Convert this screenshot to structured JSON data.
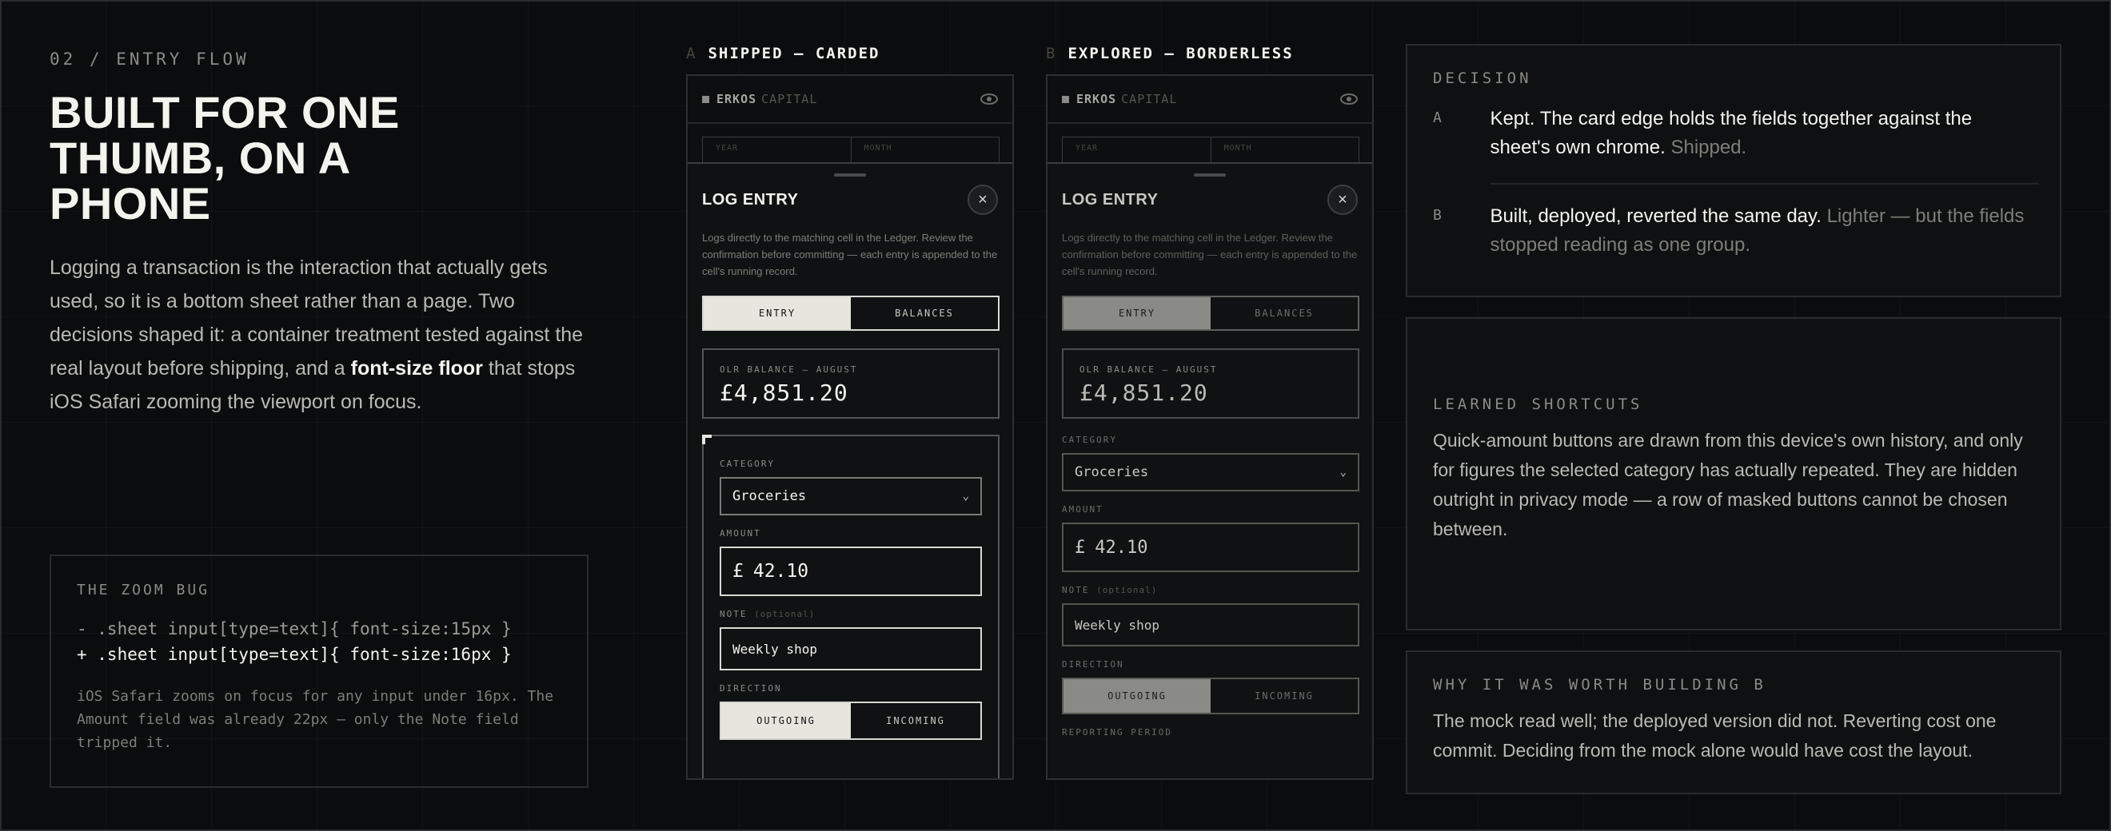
{
  "intro": {
    "eyebrow": "02 / ENTRY FLOW",
    "headline": "BUILT FOR ONE THUMB, ON A PHONE",
    "body_before": "Logging a transaction is the interaction that actually gets used, so it is a bottom sheet rather than a page. Two decisions shaped it: a container treatment tested against the real layout before shipping, and a ",
    "body_strong": "font-size floor",
    "body_after": " that stops iOS Safari zooming the viewport on focus."
  },
  "zoom_bug": {
    "title": "THE ZOOM BUG",
    "removed": "- .sheet input[type=text]{ font-size:15px }",
    "added": "+ .sheet input[type=text]{ font-size:16px }",
    "note": "iOS Safari zooms on focus for any input under 16px. The Amount field was already 22px — only the Note field tripped it."
  },
  "variants": [
    {
      "letter": "A",
      "label": "SHIPPED — CARDED",
      "brand_a": "ERKOS",
      "brand_b": "CAPITAL",
      "bg_year": "YEAR",
      "bg_month": "MONTH",
      "sheet_title": "LOG ENTRY",
      "close_glyph": "×",
      "sheet_desc": "Logs directly to the matching cell in the Ledger. Review the confirmation before committing — each entry is appended to the cell's running record.",
      "tab_entry": "ENTRY",
      "tab_balances": "BALANCES",
      "balance_label": "OLR BALANCE — AUGUST",
      "balance_value": "£4,851.20",
      "category_label": "CATEGORY",
      "category_value": "Groceries",
      "amount_label": "AMOUNT",
      "currency": "£",
      "amount_value": "42.10",
      "note_label": "NOTE",
      "note_optional": "(optional)",
      "note_value": "Weekly shop",
      "direction_label": "DIRECTION",
      "dir_out": "OUTGOING",
      "dir_in": "INCOMING"
    },
    {
      "letter": "B",
      "label": "EXPLORED — BORDERLESS",
      "brand_a": "ERKOS",
      "brand_b": "CAPITAL",
      "bg_year": "YEAR",
      "bg_month": "MONTH",
      "sheet_title": "LOG ENTRY",
      "close_glyph": "×",
      "sheet_desc": "Logs directly to the matching cell in the Ledger. Review the confirmation before committing — each entry is appended to the cell's running record.",
      "tab_entry": "ENTRY",
      "tab_balances": "BALANCES",
      "balance_label": "OLR BALANCE — AUGUST",
      "balance_value": "£4,851.20",
      "category_label": "CATEGORY",
      "category_value": "Groceries",
      "amount_label": "AMOUNT",
      "currency": "£",
      "amount_value": "42.10",
      "note_label": "NOTE",
      "note_optional": "(optional)",
      "note_value": "Weekly shop",
      "direction_label": "DIRECTION",
      "dir_out": "OUTGOING",
      "dir_in": "INCOMING",
      "period_label": "REPORTING PERIOD"
    }
  ],
  "decision": {
    "title": "DECISION",
    "rows": [
      {
        "letter": "A",
        "main": "Kept. The card edge holds the fields together against the sheet's own chrome.",
        "dim": " Shipped."
      },
      {
        "letter": "B",
        "main": "Built, deployed, reverted the same day.",
        "dim": " Lighter — but the fields stopped reading as one group."
      }
    ]
  },
  "shortcuts": {
    "title": "LEARNED SHORTCUTS",
    "body": "Quick-amount buttons are drawn from this device's own history, and only for figures the selected category has actually repeated. They are hidden outright in privacy mode — a row of masked buttons cannot be chosen between."
  },
  "worth": {
    "title": "WHY IT WAS WORTH BUILDING B",
    "body": "The mock read well; the deployed version did not. Reverting cost one commit. Deciding from the mock alone would have cost the layout."
  },
  "icons": {
    "eye": "eye-icon",
    "close": "close-icon",
    "chevron": "chevron-down-icon"
  }
}
